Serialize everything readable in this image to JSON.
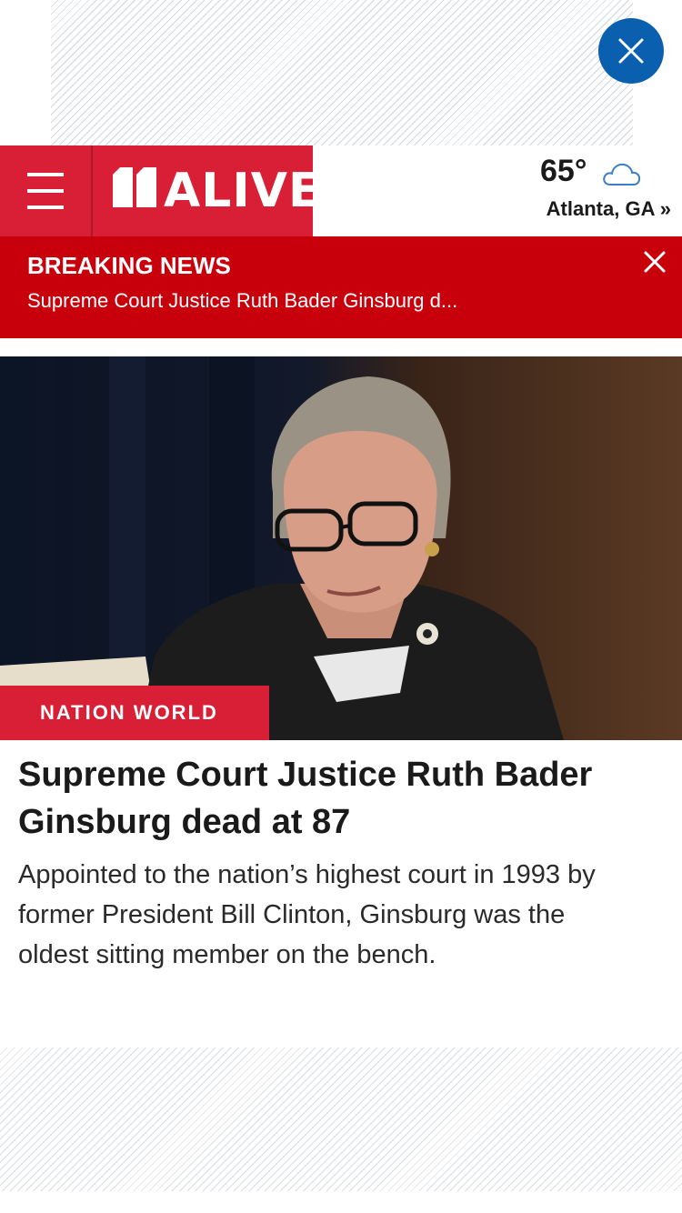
{
  "ad": {
    "close_icon": "close-icon",
    "close_color": "#0a5fae"
  },
  "header": {
    "menu_icon": "hamburger-menu-icon",
    "logo_text": "ALIVE",
    "logo_number": "11",
    "brand_color": "#d81f35",
    "weather": {
      "temperature": "65°",
      "icon": "cloud-icon",
      "location": "Atlanta, GA »"
    }
  },
  "breaking": {
    "title": "BREAKING NEWS",
    "text": "Supreme Court Justice Ruth Bader Ginsburg d...",
    "close_icon": "close-icon",
    "color": "#c8000b"
  },
  "article": {
    "category": "NATION WORLD",
    "headline": "Supreme Court Justice Ruth Bader Ginsburg dead at 87",
    "summary": "Appointed to the nation’s highest court in 1993 by former President Bill Clinton, Ginsburg was the oldest sitting member on the bench."
  }
}
